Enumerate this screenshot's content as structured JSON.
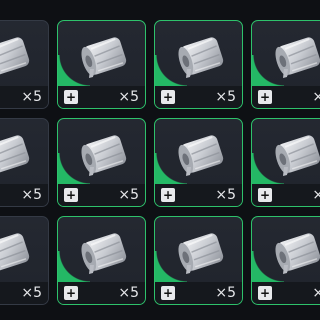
{
  "inventory": {
    "quantity_label": "×5",
    "plus_symbol": "+",
    "item_icon": "bandage-roll-icon",
    "accent_color": "#2ec26b",
    "rows": [
      {
        "slots": [
          {
            "quantity": "×5",
            "selected": false,
            "show_plus": false
          },
          {
            "quantity": "×5",
            "selected": true,
            "show_plus": true
          },
          {
            "quantity": "×5",
            "selected": true,
            "show_plus": true
          },
          {
            "quantity": "×5",
            "selected": true,
            "show_plus": true
          }
        ]
      },
      {
        "slots": [
          {
            "quantity": "×5",
            "selected": false,
            "show_plus": false
          },
          {
            "quantity": "×5",
            "selected": true,
            "show_plus": true
          },
          {
            "quantity": "×5",
            "selected": true,
            "show_plus": true
          },
          {
            "quantity": "×5",
            "selected": true,
            "show_plus": true
          }
        ]
      },
      {
        "slots": [
          {
            "quantity": "×5",
            "selected": false,
            "show_plus": false
          },
          {
            "quantity": "×5",
            "selected": true,
            "show_plus": true
          },
          {
            "quantity": "×5",
            "selected": true,
            "show_plus": true
          },
          {
            "quantity": "×5",
            "selected": true,
            "show_plus": true
          }
        ]
      }
    ]
  }
}
